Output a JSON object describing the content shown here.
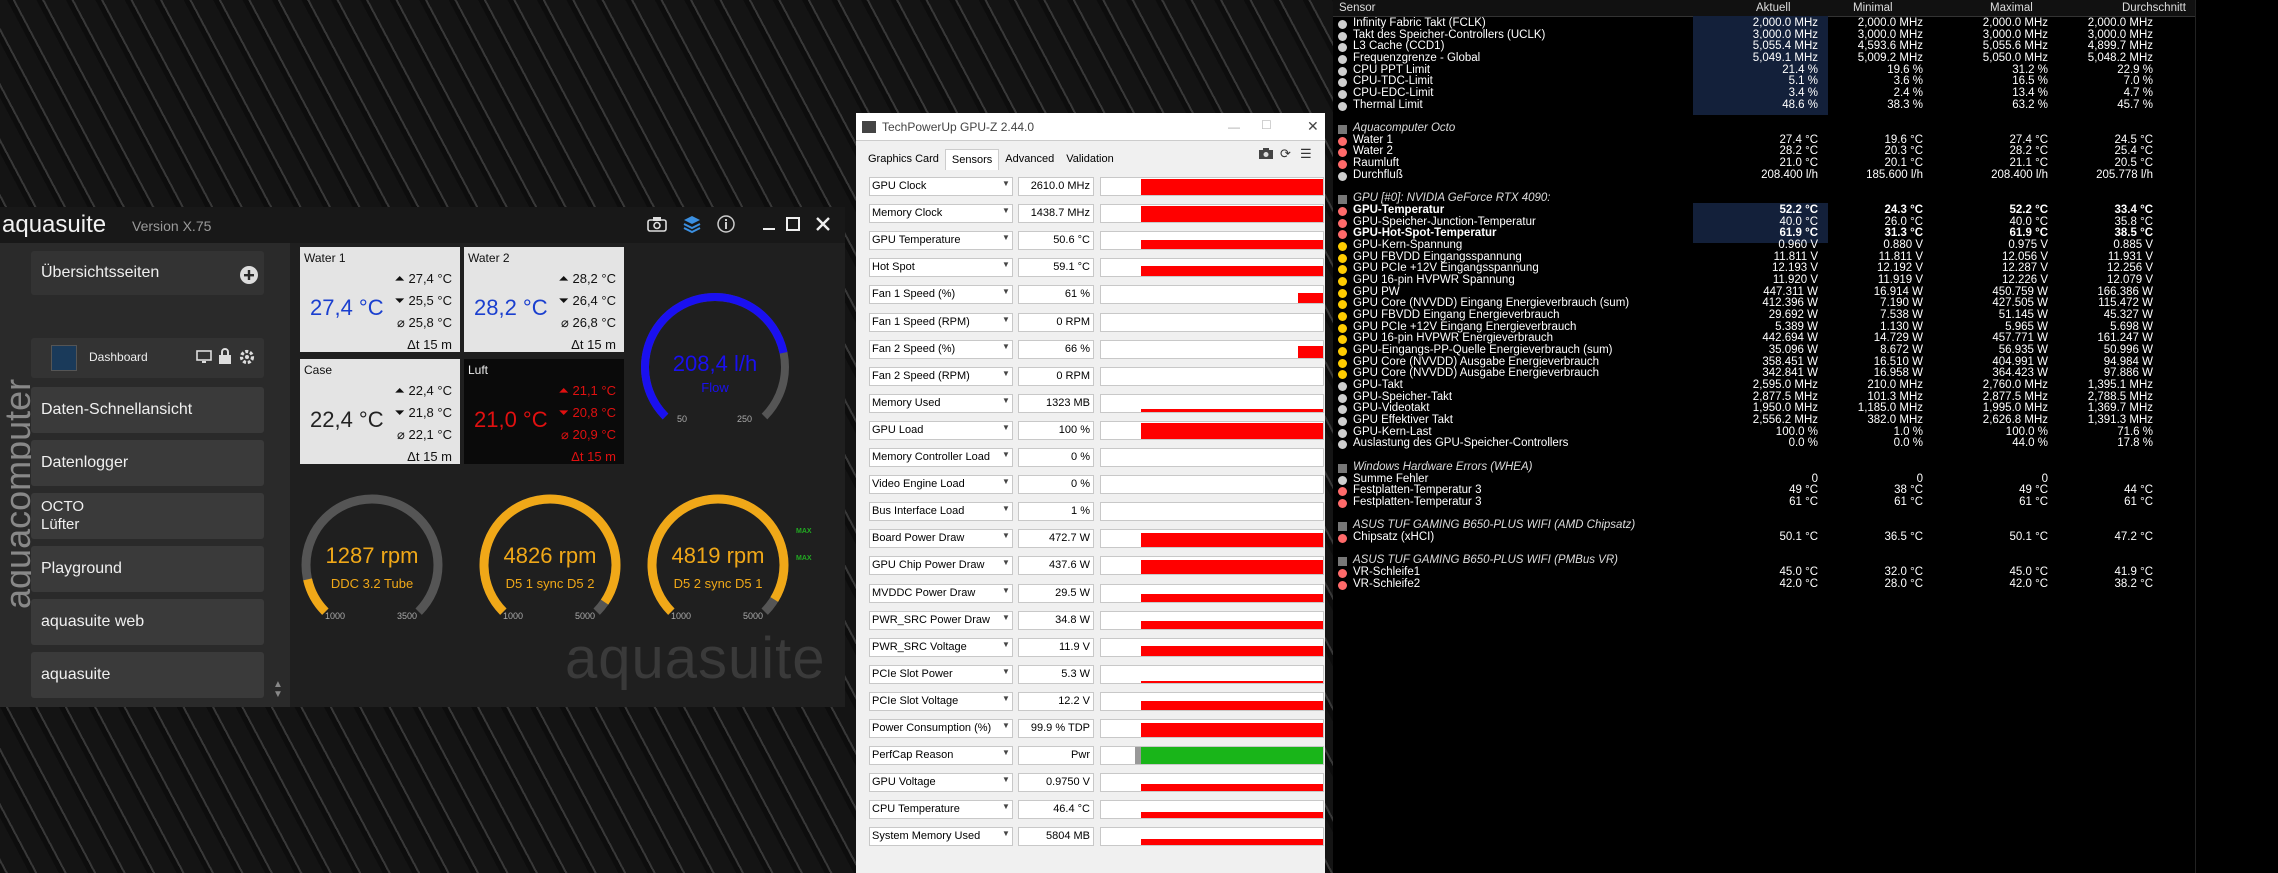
{
  "aquasuite": {
    "title": "aquasuite",
    "version": "Version X.75",
    "side_logo": "aquacomputer",
    "watermark": "aquasuite",
    "nav": {
      "overview": "Übersichtsseiten",
      "dashboard": "Dashboard",
      "quick_view": "Daten-Schnellansicht",
      "logger": "Datenlogger",
      "octo": "OCTO",
      "fans": "Lüfter",
      "playground": "Playground",
      "web": "aquasuite web",
      "aquasuite": "aquasuite"
    },
    "tiles": [
      {
        "title": "Water 1",
        "value": "27,4 °C",
        "max": "27,4 °C",
        "min": "25,5 °C",
        "avg": "25,8 °C",
        "span": "15 m"
      },
      {
        "title": "Water 2",
        "value": "28,2 °C",
        "max": "28,2 °C",
        "min": "26,4 °C",
        "avg": "26,8 °C",
        "span": "15 m"
      },
      {
        "title": "Case",
        "value": "22,4 °C",
        "max": "22,4 °C",
        "min": "21,8 °C",
        "avg": "22,1 °C",
        "span": "15 m"
      },
      {
        "title": "Luft",
        "value": "21,0 °C",
        "max": "21,1 °C",
        "min": "20,8 °C",
        "avg": "20,9 °C",
        "span": "15 m"
      }
    ],
    "flow": {
      "value": "208,4 l/h",
      "label": "Flow",
      "min": "50",
      "max": "250",
      "level": 0.79
    },
    "gauges": [
      {
        "value": "1287 rpm",
        "label": "DDC 3.2 Tube",
        "min": "1000",
        "max": "3500",
        "level": 0.12
      },
      {
        "value": "4826 rpm",
        "label": "D5 1 sync D5 2",
        "min": "1000",
        "max": "5000",
        "level": 0.96
      },
      {
        "value": "4819 rpm",
        "label": "D5 2 sync D5 1",
        "min": "1000",
        "max": "5000",
        "level": 0.95
      }
    ]
  },
  "gpuz": {
    "title": "TechPowerUp GPU-Z 2.44.0",
    "tabs": [
      "Graphics Card",
      "Sensors",
      "Advanced",
      "Validation"
    ],
    "rows": [
      {
        "name": "GPU Clock",
        "value": "2610.0 MHz",
        "bar": "red",
        "level": 0.95
      },
      {
        "name": "Memory Clock",
        "value": "1438.7 MHz",
        "bar": "red",
        "level": 0.95
      },
      {
        "name": "GPU Temperature",
        "value": "50.6 °C",
        "bar": "red",
        "level": 0.55
      },
      {
        "name": "Hot Spot",
        "value": "59.1 °C",
        "bar": "red",
        "level": 0.6
      },
      {
        "name": "Fan 1 Speed (%)",
        "value": "61 %",
        "bar": "red",
        "level": 0.61,
        "partial": 0.12
      },
      {
        "name": "Fan 1 Speed (RPM)",
        "value": "0 RPM",
        "bar": "none",
        "level": 0
      },
      {
        "name": "Fan 2 Speed (%)",
        "value": "66 %",
        "bar": "red",
        "level": 0.66,
        "partial": 0.12
      },
      {
        "name": "Fan 2 Speed (RPM)",
        "value": "0 RPM",
        "bar": "none",
        "level": 0
      },
      {
        "name": "Memory Used",
        "value": "1323 MB",
        "bar": "red",
        "level": 0.15
      },
      {
        "name": "GPU Load",
        "value": "100 %",
        "bar": "red",
        "level": 0.95
      },
      {
        "name": "Memory Controller Load",
        "value": "0 %",
        "bar": "none",
        "level": 0
      },
      {
        "name": "Video Engine Load",
        "value": "0 %",
        "bar": "none",
        "level": 0
      },
      {
        "name": "Bus Interface Load",
        "value": "1 %",
        "bar": "none",
        "level": 0
      },
      {
        "name": "Board Power Draw",
        "value": "472.7 W",
        "bar": "red",
        "level": 0.85,
        "tag": "MAX"
      },
      {
        "name": "GPU Chip Power Draw",
        "value": "437.6 W",
        "bar": "red",
        "level": 0.85,
        "tag": "MAX"
      },
      {
        "name": "MVDDC Power Draw",
        "value": "29.5 W",
        "bar": "red",
        "level": 0.45
      },
      {
        "name": "PWR_SRC Power Draw",
        "value": "34.8 W",
        "bar": "red",
        "level": 0.45
      },
      {
        "name": "PWR_SRC Voltage",
        "value": "11.9 V",
        "bar": "red",
        "level": 0.55
      },
      {
        "name": "PCIe Slot Power",
        "value": "5.3 W",
        "bar": "red",
        "level": 0.1
      },
      {
        "name": "PCIe Slot Voltage",
        "value": "12.2 V",
        "bar": "red",
        "level": 0.55
      },
      {
        "name": "Power Consumption (%)",
        "value": "99.9 % TDP",
        "bar": "red",
        "level": 0.85
      },
      {
        "name": "PerfCap Reason",
        "value": "Pwr",
        "bar": "green",
        "level": 1
      },
      {
        "name": "GPU Voltage",
        "value": "0.9750 V",
        "bar": "red",
        "level": 0.4
      },
      {
        "name": "CPU Temperature",
        "value": "46.4 °C",
        "bar": "red",
        "level": 0.35
      },
      {
        "name": "System Memory Used",
        "value": "5804 MB",
        "bar": "red",
        "level": 0.4
      }
    ]
  },
  "hwinfo": {
    "headers": {
      "sensor": "Sensor",
      "current": "Aktuell",
      "min": "Minimal",
      "max": "Maximal",
      "avg": "Durchschnitt"
    },
    "rows": [
      {
        "t": "d",
        "icon": "clock",
        "name": "Infinity Fabric Takt (FCLK)",
        "cur": "2,000.0 MHz",
        "min": "2,000.0 MHz",
        "max": "2,000.0 MHz",
        "avg": "2,000.0 MHz"
      },
      {
        "t": "d",
        "icon": "clock",
        "name": "Takt des Speicher-Controllers (UCLK)",
        "cur": "3,000.0 MHz",
        "min": "3,000.0 MHz",
        "max": "3,000.0 MHz",
        "avg": "3,000.0 MHz"
      },
      {
        "t": "d",
        "icon": "clock",
        "name": "L3 Cache (CCD1)",
        "cur": "5,055.4 MHz",
        "min": "4,593.6 MHz",
        "max": "5,055.6 MHz",
        "avg": "4,899.7 MHz"
      },
      {
        "t": "d",
        "icon": "clock",
        "name": "Frequenzgrenze - Global",
        "cur": "5,049.1 MHz",
        "min": "5,009.2 MHz",
        "max": "5,050.0 MHz",
        "avg": "5,048.2 MHz"
      },
      {
        "t": "d",
        "icon": "gauge",
        "name": "CPU PPT Limit",
        "cur": "21.4 %",
        "min": "19.6 %",
        "max": "31.2 %",
        "avg": "22.9 %"
      },
      {
        "t": "d",
        "icon": "gauge",
        "name": "CPU-TDC-Limit",
        "cur": "5.1 %",
        "min": "3.6 %",
        "max": "16.5 %",
        "avg": "7.0 %"
      },
      {
        "t": "d",
        "icon": "gauge",
        "name": "CPU-EDC-Limit",
        "cur": "3.4 %",
        "min": "2.4 %",
        "max": "13.4 %",
        "avg": "4.7 %"
      },
      {
        "t": "d",
        "icon": "gauge",
        "name": "Thermal Limit",
        "cur": "48.6 %",
        "min": "38.3 %",
        "max": "63.2 %",
        "avg": "45.7 %"
      },
      {
        "t": "e"
      },
      {
        "t": "s",
        "name": "Aquacomputer Octo"
      },
      {
        "t": "d",
        "icon": "therm",
        "name": "Water 1",
        "cur": "27.4 °C",
        "min": "19.6 °C",
        "max": "27.4 °C",
        "avg": "24.5 °C"
      },
      {
        "t": "d",
        "icon": "therm",
        "name": "Water 2",
        "cur": "28.2 °C",
        "min": "20.3 °C",
        "max": "28.2 °C",
        "avg": "25.4 °C"
      },
      {
        "t": "d",
        "icon": "therm",
        "name": "Raumluft",
        "cur": "21.0 °C",
        "min": "20.1 °C",
        "max": "21.1 °C",
        "avg": "20.5 °C"
      },
      {
        "t": "d",
        "icon": "gauge",
        "name": "Durchfluß",
        "cur": "208.400 l/h",
        "min": "185.600 l/h",
        "max": "208.400 l/h",
        "avg": "205.778 l/h"
      },
      {
        "t": "e"
      },
      {
        "t": "s",
        "name": "GPU [#0]: NVIDIA GeForce RTX 4090:"
      },
      {
        "t": "d",
        "icon": "therm",
        "bold": true,
        "name": "GPU-Temperatur",
        "cur": "52.2 °C",
        "min": "24.3 °C",
        "max": "52.2 °C",
        "avg": "33.4 °C"
      },
      {
        "t": "d",
        "icon": "therm",
        "name": "GPU-Speicher-Junction-Temperatur",
        "cur": "40.0 °C",
        "min": "26.0 °C",
        "max": "40.0 °C",
        "avg": "35.8 °C"
      },
      {
        "t": "d",
        "icon": "therm",
        "bold": true,
        "name": "GPU-Hot-Spot-Temperatur",
        "cur": "61.9 °C",
        "min": "31.3 °C",
        "max": "61.9 °C",
        "avg": "38.5 °C"
      },
      {
        "t": "d",
        "icon": "bolt",
        "name": "GPU-Kern-Spannung",
        "cur": "0.960 V",
        "min": "0.880 V",
        "max": "0.975 V",
        "avg": "0.885 V"
      },
      {
        "t": "d",
        "icon": "bolt",
        "name": "GPU FBVDD Eingangsspannung",
        "cur": "11.811 V",
        "min": "11.811 V",
        "max": "12.056 V",
        "avg": "11.931 V"
      },
      {
        "t": "d",
        "icon": "bolt",
        "name": "GPU PCIe +12V Eingangsspannung",
        "cur": "12.193 V",
        "min": "12.192 V",
        "max": "12.287 V",
        "avg": "12.256 V"
      },
      {
        "t": "d",
        "icon": "bolt",
        "name": "GPU 16-pin HVPWR Spannung",
        "cur": "11.920 V",
        "min": "11.919 V",
        "max": "12.226 V",
        "avg": "12.079 V"
      },
      {
        "t": "d",
        "icon": "bolt",
        "name": "GPU PW",
        "cur": "447.311 W",
        "min": "16.914 W",
        "max": "450.759 W",
        "avg": "166.386 W"
      },
      {
        "t": "d",
        "icon": "bolt",
        "name": "GPU Core (NVVDD) Eingang Energieverbrauch (sum)",
        "cur": "412.396 W",
        "min": "7.190 W",
        "max": "427.505 W",
        "avg": "115.472 W"
      },
      {
        "t": "d",
        "icon": "bolt",
        "name": "GPU FBVDD Eingang Energieverbrauch",
        "cur": "29.692 W",
        "min": "7.538 W",
        "max": "51.145 W",
        "avg": "45.327 W"
      },
      {
        "t": "d",
        "icon": "bolt",
        "name": "GPU PCIe +12V Eingang Energieverbrauch",
        "cur": "5.389 W",
        "min": "1.130 W",
        "max": "5.965 W",
        "avg": "5.698 W"
      },
      {
        "t": "d",
        "icon": "bolt",
        "name": "GPU 16-pin HVPWR Energieverbrauch",
        "cur": "442.694 W",
        "min": "14.729 W",
        "max": "457.771 W",
        "avg": "161.247 W"
      },
      {
        "t": "d",
        "icon": "bolt",
        "name": "GPU-Eingangs-PP-Quelle Energieverbrauch (sum)",
        "cur": "35.096 W",
        "min": "8.672 W",
        "max": "56.935 W",
        "avg": "50.996 W"
      },
      {
        "t": "d",
        "icon": "bolt",
        "name": "GPU Core (NVVDD) Ausgabe Energieverbrauch",
        "cur": "358.451 W",
        "min": "16.510 W",
        "max": "404.991 W",
        "avg": "94.984 W"
      },
      {
        "t": "d",
        "icon": "bolt",
        "name": "GPU Core (NVVDD) Ausgabe Energieverbrauch",
        "cur": "342.841 W",
        "min": "16.958 W",
        "max": "364.423 W",
        "avg": "97.886 W"
      },
      {
        "t": "d",
        "icon": "clock",
        "name": "GPU-Takt",
        "cur": "2,595.0 MHz",
        "min": "210.0 MHz",
        "max": "2,760.0 MHz",
        "avg": "1,395.1 MHz"
      },
      {
        "t": "d",
        "icon": "clock",
        "name": "GPU-Speicher-Takt",
        "cur": "2,877.5 MHz",
        "min": "101.3 MHz",
        "max": "2,877.5 MHz",
        "avg": "2,788.5 MHz"
      },
      {
        "t": "d",
        "icon": "clock",
        "name": "GPU-Videotakt",
        "cur": "1,950.0 MHz",
        "min": "1,185.0 MHz",
        "max": "1,995.0 MHz",
        "avg": "1,369.7 MHz"
      },
      {
        "t": "d",
        "icon": "clock",
        "name": "GPU Effektiver Takt",
        "cur": "2,556.2 MHz",
        "min": "382.0 MHz",
        "max": "2,626.8 MHz",
        "avg": "1,391.3 MHz"
      },
      {
        "t": "d",
        "icon": "gauge",
        "name": "GPU-Kern-Last",
        "cur": "100.0 %",
        "min": "1.0 %",
        "max": "100.0 %",
        "avg": "71.6 %"
      },
      {
        "t": "d",
        "icon": "gauge",
        "name": "Auslastung des GPU-Speicher-Controllers",
        "cur": "0.0 %",
        "min": "0.0 %",
        "max": "44.0 %",
        "avg": "17.8 %"
      },
      {
        "t": "e"
      },
      {
        "t": "s",
        "name": "Windows Hardware Errors (WHEA)"
      },
      {
        "t": "d",
        "icon": "gauge",
        "name": "Summe Fehler",
        "cur": "0",
        "min": "0",
        "max": "0",
        "avg": ""
      },
      {
        "t": "d",
        "icon": "therm",
        "name": "Festplatten-Temperatur 3",
        "cur": "49 °C",
        "min": "38 °C",
        "max": "49 °C",
        "avg": "44 °C"
      },
      {
        "t": "d",
        "icon": "therm",
        "name": "Festplatten-Temperatur 3",
        "cur": "61 °C",
        "min": "61 °C",
        "max": "61 °C",
        "avg": "61 °C"
      },
      {
        "t": "e"
      },
      {
        "t": "s",
        "name": "ASUS TUF GAMING B650-PLUS WIFI (AMD Chipsatz)"
      },
      {
        "t": "d",
        "icon": "therm",
        "name": "Chipsatz (xHCI)",
        "cur": "50.1 °C",
        "min": "36.5 °C",
        "max": "50.1 °C",
        "avg": "47.2 °C"
      },
      {
        "t": "e"
      },
      {
        "t": "s",
        "name": "ASUS TUF GAMING B650-PLUS WIFI (PMBus VR)"
      },
      {
        "t": "d",
        "icon": "therm",
        "name": "VR-Schleife1",
        "cur": "45.0 °C",
        "min": "32.0 °C",
        "max": "45.0 °C",
        "avg": "41.9 °C"
      },
      {
        "t": "d",
        "icon": "therm",
        "name": "VR-Schleife2",
        "cur": "42.0 °C",
        "min": "28.0 °C",
        "max": "42.0 °C",
        "avg": "38.2 °C"
      }
    ]
  },
  "colors": {
    "tile_bg": "#e4e4e4",
    "tile_alert_bg": "#0a0a0a",
    "tile_value": "#1a3fcf",
    "alert_red": "#e01010",
    "flow_blue": "#1a10f0",
    "gauge_orange": "#f0a818",
    "gauge_track": "#555555",
    "gpuz_red": "#ff0000",
    "gpuz_green": "#19b519",
    "hw_selected": "#13203a"
  }
}
